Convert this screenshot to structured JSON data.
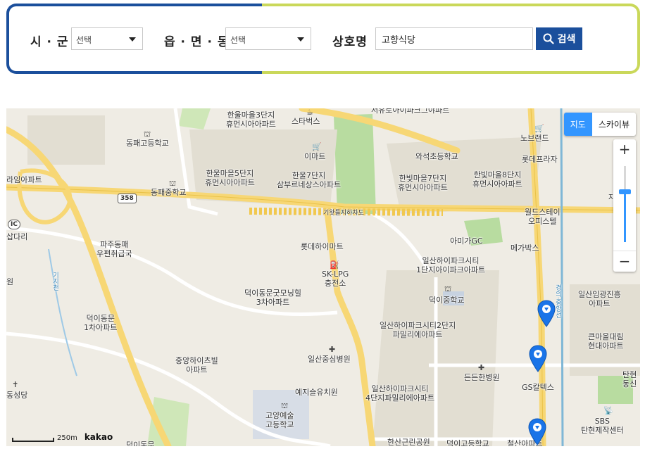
{
  "search": {
    "sigun_label": "시 · 군",
    "sigun_value": "선택",
    "eupmyeon_label": "읍 · 면 · 동",
    "eupmyeon_value": "선택",
    "name_label": "상호명",
    "name_value": "고향식당",
    "button_label": "검색",
    "colors": {
      "primary": "#1b4f9c",
      "accent": "#cad85a"
    }
  },
  "map": {
    "map_type": {
      "map": "지도",
      "skyview": "스카이뷰",
      "active": "지도"
    },
    "zoom": {
      "in": "+",
      "out": "−",
      "level_fraction": 0.33
    },
    "scale": "250m",
    "attribution": "kakao",
    "road_shield": "358",
    "expressway_name": "기왓들지하차도",
    "labels": {
      "l01": "서유로아이파크그야파트",
      "l02": "한울마을3단지\n휴먼시아아파트",
      "l03": "스타벅스",
      "l04": "동패고등학교",
      "l05": "이마트",
      "l06": "한울마을5단지\n휴먼시아아파트",
      "l07": "한울7단지\n삼부르네상스아파트",
      "l08": "와석초등학교",
      "l09": "한빛마을7단지\n휴먼시아아파트",
      "l10": "한빛마을8단지\n휴먼시아아파트",
      "l11": "동패중학교",
      "l12": "노브랜드",
      "l13": "롯데프라자",
      "l14": "라임아파트",
      "l15": "월드스테이\n오피스텔",
      "l16": "파주동패\n우편취급국",
      "l17": "롯데하이마트",
      "l18": "아미가GC",
      "l19": "메가박스",
      "l20": "SK-LPG\n충전소",
      "l21": "일산하이파크시티\n1단지아이파크아파트",
      "l22": "덕이동문굿모닝힐\n3차아파트",
      "l23": "덕이중학교",
      "l24": "일산임광진흥\n아파트",
      "l25": "덕이동문\n1차아파트",
      "l26": "일산하이파크시티2단지\n파밀리에아파트",
      "l27": "큰마을대림\n현대아파트",
      "l28": "중앙하이츠빌\n아파트",
      "l29": "일산중심병원",
      "l30": "든든한병원",
      "l31": "탄현\n동신",
      "l32": "예지슬유치원",
      "l33": "일산하이파크시티\n4단지파밀리에아파트",
      "l34": "GS칼텍스",
      "l35": "SBS\n탄현제작센터",
      "l36": "고양예술\n고등학교",
      "l37": "한산근린공원",
      "l38": "덕이고등학교",
      "l39": "철산아파트",
      "l40": "덕이동문",
      "l41": "동성당",
      "l42": "삽다리",
      "l43": "원",
      "l44": "자",
      "l45": "경의·중앙선",
      "l46": "기지천",
      "l47": "IC"
    },
    "markers": [
      "place-marker-1",
      "place-marker-2",
      "place-marker-3"
    ]
  }
}
